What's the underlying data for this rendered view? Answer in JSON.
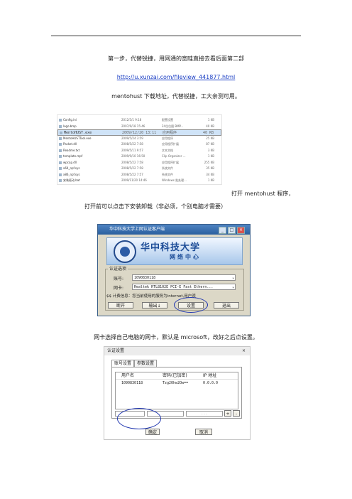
{
  "step1_text": "第一步，代替锐捷，用网通的宽畦直接去看后面第二部",
  "download_link": "http://u.xunzai.com/fileview_441877.html",
  "download_note": "mentohust 下载地址，代替锐捷，工大亲测可用。",
  "file_list": [
    {
      "name": "Config.ini",
      "date": "2012/5/1 9:18",
      "type": "配置设置",
      "size": "1 KB"
    },
    {
      "name": "logo.bmp",
      "date": "2007/6/18 15:46",
      "type": "24位位图 BMP...",
      "size": "40 KB"
    },
    {
      "name": "MentoHUST.exe",
      "date": "2009/12/20 13:11",
      "type": "应用程序",
      "size": "40 KB",
      "selected": true
    },
    {
      "name": "MentoHUSTTool.exe",
      "date": "2009/5/24 3:59",
      "type": "应用程序",
      "size": "25 KB"
    },
    {
      "name": "Packet.dll",
      "date": "2008/5/22 7:58",
      "type": "应用程序扩展",
      "size": "87 KB"
    },
    {
      "name": "Readme.txt",
      "date": "2009/5/11 9:57",
      "type": "文本文档",
      "size": "3 KB"
    },
    {
      "name": "template.mpf",
      "date": "2009/9/10 16:50",
      "type": "Clip Organizer ...",
      "size": "1 KB"
    },
    {
      "name": "wpcap.dll",
      "date": "2008/5/22 7:58",
      "type": "应用程序扩展",
      "size": "255 KB"
    },
    {
      "name": "x64_npf.sys",
      "date": "2008/5/22 7:58",
      "type": "系统文件",
      "size": "35 KB"
    },
    {
      "name": "x86_npf.sys",
      "date": "2008/5/22 7:57",
      "type": "系统文件",
      "size": "34 KB"
    },
    {
      "name": "安装驱动.bat",
      "date": "2009/11/20 14:46",
      "type": "Windows 批处理...",
      "size": "1 KB"
    }
  ],
  "open_text_1": "打开 mentohust 程序，",
  "open_text_2": "打开前可以点击下安装卸载（非必须，个别电脑才需要）",
  "dialog1": {
    "title": "华中科技大学上网认证客户端",
    "banner_big": "华中科技大学",
    "banner_small": "网络中心",
    "group_label": "认证选项",
    "account_label": "账号:",
    "account_value": "1090830118",
    "nic_label": "网卡:",
    "nic_value": "Realtek RTL8102E PCI-E Fast Ethern...",
    "status_line": "$$ 计费信息：您当前使用的服务为internet,用户须",
    "buttons": [
      "断开",
      "输出↓",
      "设置",
      "退出"
    ],
    "titlebar_buttons": [
      "_",
      "□",
      "×"
    ]
  },
  "caption_nic": "网卡选择自己电脑的网卡，默认是 microsoft，改好之后点设置。",
  "dialog2": {
    "title": "认证设置",
    "close": "×",
    "tabs": [
      "账号设置",
      "参数设置"
    ],
    "columns": [
      "用户名",
      "密码(已加密)",
      "IP 地址"
    ],
    "row": [
      "1090830118",
      "Tzg2Ohw2Ow==",
      "0.0.0.0"
    ],
    "ip_placeholder": ". . .",
    "plus": "+",
    "minus": "-",
    "ok": "确定",
    "cancel": "取消"
  }
}
